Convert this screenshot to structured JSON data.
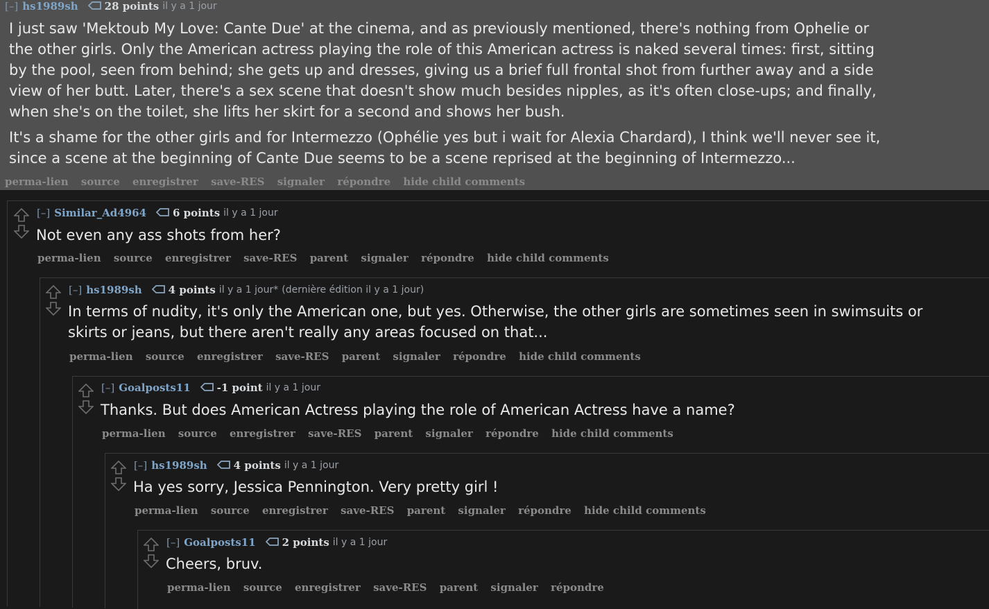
{
  "comments": [
    {
      "expand": "[–]",
      "author": "hs1989sh",
      "score": "28 points",
      "time": "il y a 1 jour",
      "edit": "",
      "paragraphs": [
        "I just saw 'Mektoub My Love: Cante Due' at the cinema, and as previously mentioned, there's nothing from Ophelie or the other girls. Only the American actress playing the role of this American actress is naked several times: first, sitting by the pool, seen from behind; she gets up and dresses, giving us a brief full frontal shot from further away and a side view of her butt. Later, there's a sex scene that doesn't show much besides nipples, as it's often close-ups; and finally, when she's on the toilet, she lifts her skirt for a second and shows her bush.",
        "It's a shame for the other girls and for Intermezzo (Ophélie yes but i wait for Alexia Chardard), I think we'll never see it, since a scene at the beginning of Cante Due seems to be a scene reprised at the beginning of Intermezzo..."
      ],
      "buttons": [
        "perma-lien",
        "source",
        "enregistrer",
        "save-RES",
        "signaler",
        "répondre",
        "hide child comments"
      ]
    },
    {
      "expand": "[–]",
      "author": "Similar_Ad4964",
      "score": "6 points",
      "time": "il y a 1 jour",
      "edit": "",
      "paragraphs": [
        "Not even any ass shots from her?"
      ],
      "buttons": [
        "perma-lien",
        "source",
        "enregistrer",
        "save-RES",
        "parent",
        "signaler",
        "répondre",
        "hide child comments"
      ]
    },
    {
      "expand": "[–]",
      "author": "hs1989sh",
      "score": "4 points",
      "time": "il y a 1 jour*",
      "edit": "(dernière édition il y a 1 jour)",
      "paragraphs": [
        "In terms of nudity, it's only the American one, but yes. Otherwise, the other girls are sometimes seen in swimsuits or skirts or jeans, but there aren't really any areas focused on that..."
      ],
      "buttons": [
        "perma-lien",
        "source",
        "enregistrer",
        "save-RES",
        "parent",
        "signaler",
        "répondre",
        "hide child comments"
      ]
    },
    {
      "expand": "[–]",
      "author": "Goalposts11",
      "score": "-1 point",
      "time": "il y a 1 jour",
      "edit": "",
      "paragraphs": [
        "Thanks. But does American Actress playing the role of American Actress have a name?"
      ],
      "buttons": [
        "perma-lien",
        "source",
        "enregistrer",
        "save-RES",
        "parent",
        "signaler",
        "répondre",
        "hide child comments"
      ]
    },
    {
      "expand": "[–]",
      "author": "hs1989sh",
      "score": "4 points",
      "time": "il y a 1 jour",
      "edit": "",
      "paragraphs": [
        "Ha yes sorry, Jessica Pennington. Very pretty girl !"
      ],
      "buttons": [
        "perma-lien",
        "source",
        "enregistrer",
        "save-RES",
        "parent",
        "signaler",
        "répondre",
        "hide child comments"
      ]
    },
    {
      "expand": "[–]",
      "author": "Goalposts11",
      "score": "2 points",
      "time": "il y a 1 jour",
      "edit": "",
      "paragraphs": [
        "Cheers, bruv."
      ],
      "buttons": [
        "perma-lien",
        "source",
        "enregistrer",
        "save-RES",
        "parent",
        "signaler",
        "répondre"
      ]
    }
  ]
}
